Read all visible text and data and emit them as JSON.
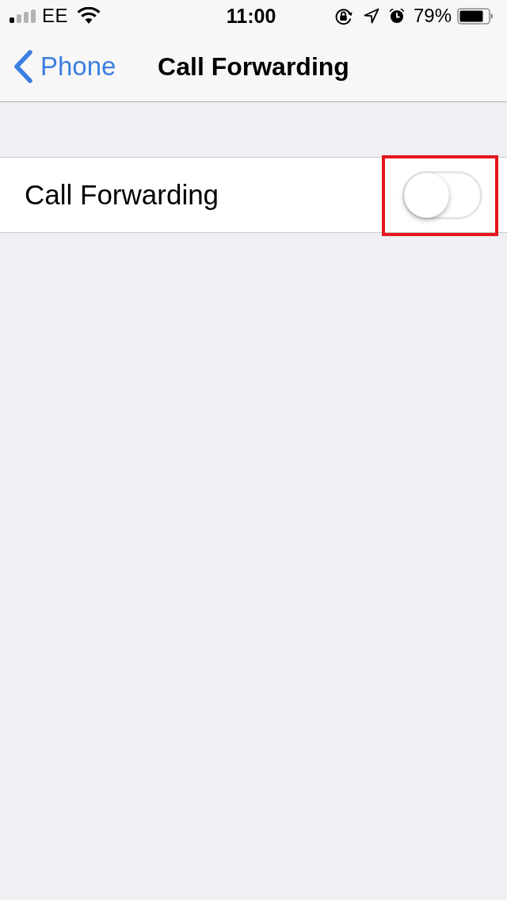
{
  "status_bar": {
    "carrier": "EE",
    "time": "11:00",
    "battery": "79%"
  },
  "nav_bar": {
    "back": {
      "label": "Phone"
    },
    "title": "Call Forwarding"
  },
  "settings": [
    {
      "kind": "toggle",
      "label": "Call Forwarding",
      "on": false,
      "highlighted": true
    }
  ]
}
